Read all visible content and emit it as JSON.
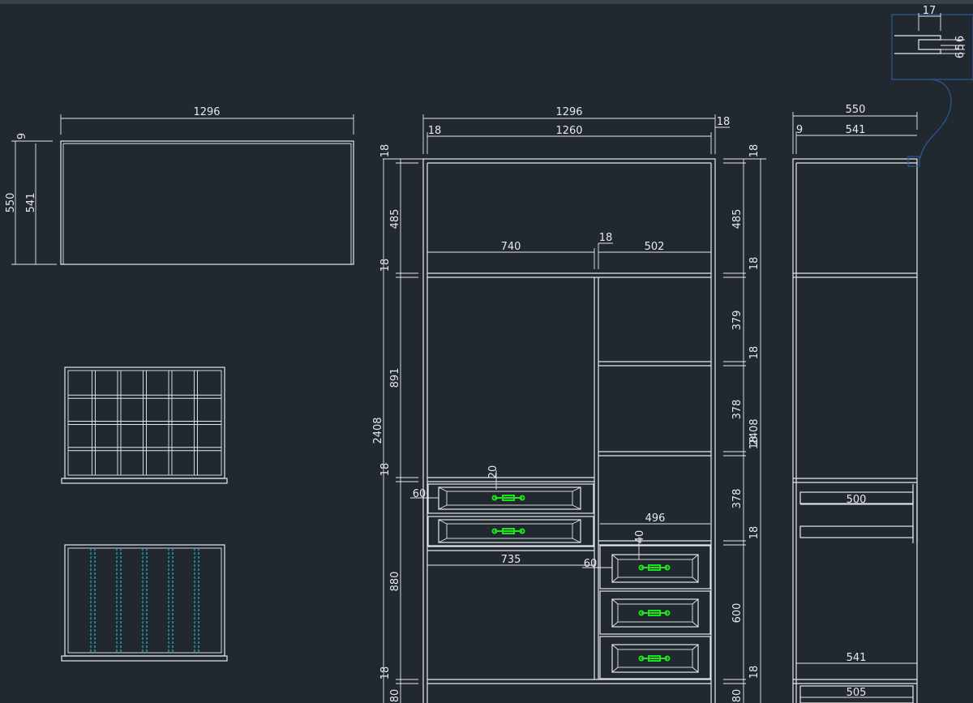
{
  "labels": {
    "top_width": "1296",
    "top_thick": "9",
    "top_depth_total": "550",
    "top_depth_inner": "541",
    "front_width": "1296",
    "front_side_l": "18",
    "front_inner": "1260",
    "front_side_r": "18",
    "front_top_panel": "18",
    "front_h_485": "485",
    "front_shelf_18a": "18",
    "front_h_891": "891",
    "front_total_h": "2408",
    "front_shelf_18b": "18",
    "front_h_880": "880",
    "front_bottom_18": "18",
    "front_plinth_80": "80",
    "front_w_740": "740",
    "front_div_18": "18",
    "front_w_502": "502",
    "front_drawer_gap_20": "20",
    "front_drawer_60a": "60",
    "front_w_735": "735",
    "front_w_496": "496",
    "front_drawer_40": "40",
    "front_drawer_60b": "60",
    "right_top_18": "18",
    "right_h_485": "485",
    "right_shelf_18a": "18",
    "right_h_379": "379",
    "right_shelf_18b": "18",
    "right_h_378a": "378",
    "right_total_2408": "2408",
    "right_shelf_18c": "18",
    "right_h_378b": "378",
    "right_shelf_18d": "18",
    "right_h_600": "600",
    "right_bottom_18": "18",
    "right_plinth_80": "80",
    "side_depth": "550",
    "side_thick": "9",
    "side_inner": "541",
    "side_drawer_500": "500",
    "side_bottom_541": "541",
    "side_bottom_505": "505",
    "detail_17": "17",
    "detail_6": "6",
    "detail_5": "5",
    "detail_6b": "6"
  },
  "colors": {
    "background": "#212830",
    "line": "#e6e9ec",
    "handle": "#19e619",
    "dashed": "#18c9d8",
    "callout": "#2a5a9a"
  }
}
